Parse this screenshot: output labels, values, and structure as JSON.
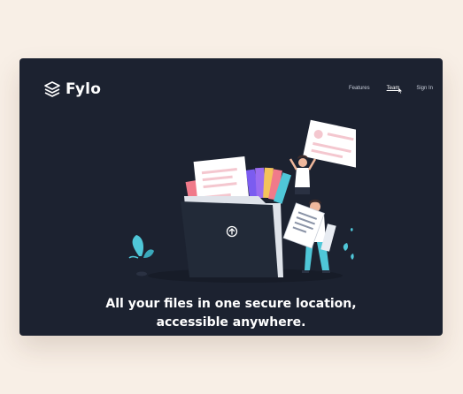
{
  "brand": {
    "name": "Fylo",
    "icon": "stacked-layers-icon"
  },
  "nav": {
    "items": [
      {
        "label": "Features",
        "active": false
      },
      {
        "label": "Team",
        "active": true
      },
      {
        "label": "Sign In",
        "active": false
      }
    ]
  },
  "hero": {
    "headline_line1": "All your files in one secure location,",
    "headline_line2": "accessible anywhere.",
    "upload_icon": "upload-arrow-icon"
  },
  "colors": {
    "page_background": "#f8efe6",
    "card_background": "#1c2230",
    "accent_teal": "#4fc7d8",
    "accent_pink": "#f07a8a",
    "text": "#ffffff"
  }
}
